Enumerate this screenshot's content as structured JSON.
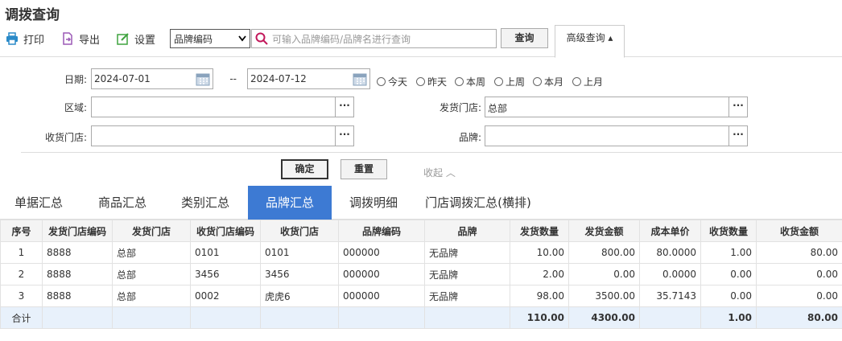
{
  "header": {
    "title": "调拨查询"
  },
  "toolbar": {
    "print_label": "打印",
    "export_label": "导出",
    "settings_label": "设置",
    "search_field_select": "品牌编码",
    "search_placeholder": "可输入品牌编码/品牌名进行查询",
    "query_label": "查询",
    "advanced_label": "高级查询 ▴"
  },
  "filters": {
    "date_label": "日期:",
    "date_from": "2024-07-01",
    "date_sep": "--",
    "date_to": "2024-07-12",
    "quick_dates": [
      "今天",
      "昨天",
      "本周",
      "上周",
      "本月",
      "上月"
    ],
    "region_label": "区域:",
    "region_value": "",
    "ship_store_label": "发货门店:",
    "ship_store_value": "总部",
    "recv_store_label": "收货门店:",
    "recv_store_value": "",
    "brand_label": "品牌:",
    "brand_value": "",
    "lookup_label": "···",
    "confirm_label": "确定",
    "reset_label": "重置",
    "collapse_label": "收起 ︿"
  },
  "tabs": [
    {
      "label": "单据汇总",
      "active": false
    },
    {
      "label": "商品汇总",
      "active": false
    },
    {
      "label": "类别汇总",
      "active": false
    },
    {
      "label": "品牌汇总",
      "active": true
    },
    {
      "label": "调拨明细",
      "active": false
    },
    {
      "label": "门店调拨汇总(横排)",
      "active": false
    }
  ],
  "table": {
    "columns": [
      "序号",
      "发货门店编码",
      "发货门店",
      "收货门店编码",
      "收货门店",
      "品牌编码",
      "品牌",
      "发货数量",
      "发货金额",
      "成本单价",
      "收货数量",
      "收货金额"
    ],
    "rows": [
      [
        "1",
        "8888",
        "总部",
        "0101",
        "0101",
        "000000",
        "无品牌",
        "10.00",
        "800.00",
        "80.0000",
        "1.00",
        "80.00"
      ],
      [
        "2",
        "8888",
        "总部",
        "3456",
        "3456",
        "000000",
        "无品牌",
        "2.00",
        "0.00",
        "0.0000",
        "0.00",
        "0.00"
      ],
      [
        "3",
        "8888",
        "总部",
        "0002",
        "虎虎6",
        "000000",
        "无品牌",
        "98.00",
        "3500.00",
        "35.7143",
        "0.00",
        "0.00"
      ]
    ],
    "total": {
      "label": "合计",
      "ship_qty": "110.00",
      "ship_amount": "4300.00",
      "recv_qty": "1.00",
      "recv_amount": "80.00"
    }
  },
  "colors": {
    "accent": "#3d7ad3",
    "print_icon": "#2a8ac8",
    "export_icon": "#9b59b6",
    "settings_icon": "#3fa33f",
    "search_icon": "#c2185b"
  },
  "icons": [
    "print-icon",
    "export-icon",
    "settings-icon",
    "search-icon",
    "calendar-icon",
    "chevron-down-icon"
  ]
}
